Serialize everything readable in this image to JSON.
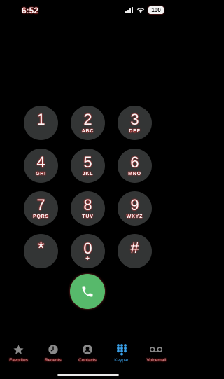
{
  "status_bar": {
    "time": "6:52",
    "battery": "100"
  },
  "keypad": {
    "keys": [
      {
        "digit": "1",
        "letters": ""
      },
      {
        "digit": "2",
        "letters": "ABC"
      },
      {
        "digit": "3",
        "letters": "DEF"
      },
      {
        "digit": "4",
        "letters": "GHI"
      },
      {
        "digit": "5",
        "letters": "JKL"
      },
      {
        "digit": "6",
        "letters": "MNO"
      },
      {
        "digit": "7",
        "letters": "PQRS"
      },
      {
        "digit": "8",
        "letters": "TUV"
      },
      {
        "digit": "9",
        "letters": "WXYZ"
      },
      {
        "digit": "*",
        "letters": ""
      },
      {
        "digit": "0",
        "letters": "+"
      },
      {
        "digit": "#",
        "letters": ""
      }
    ]
  },
  "call_button": {
    "icon": "phone-icon",
    "color": "#57b96b"
  },
  "tab_bar": {
    "active_color": "#3aa0e8",
    "inactive_color": "#b98a8f",
    "tabs": [
      {
        "label": "Favorites",
        "icon": "star-icon"
      },
      {
        "label": "Recents",
        "icon": "clock-icon"
      },
      {
        "label": "Contacts",
        "icon": "person-circle-icon"
      },
      {
        "label": "Keypad",
        "icon": "keypad-grid-icon"
      },
      {
        "label": "Voicemail",
        "icon": "voicemail-icon"
      }
    ],
    "active_tab": "Keypad"
  }
}
